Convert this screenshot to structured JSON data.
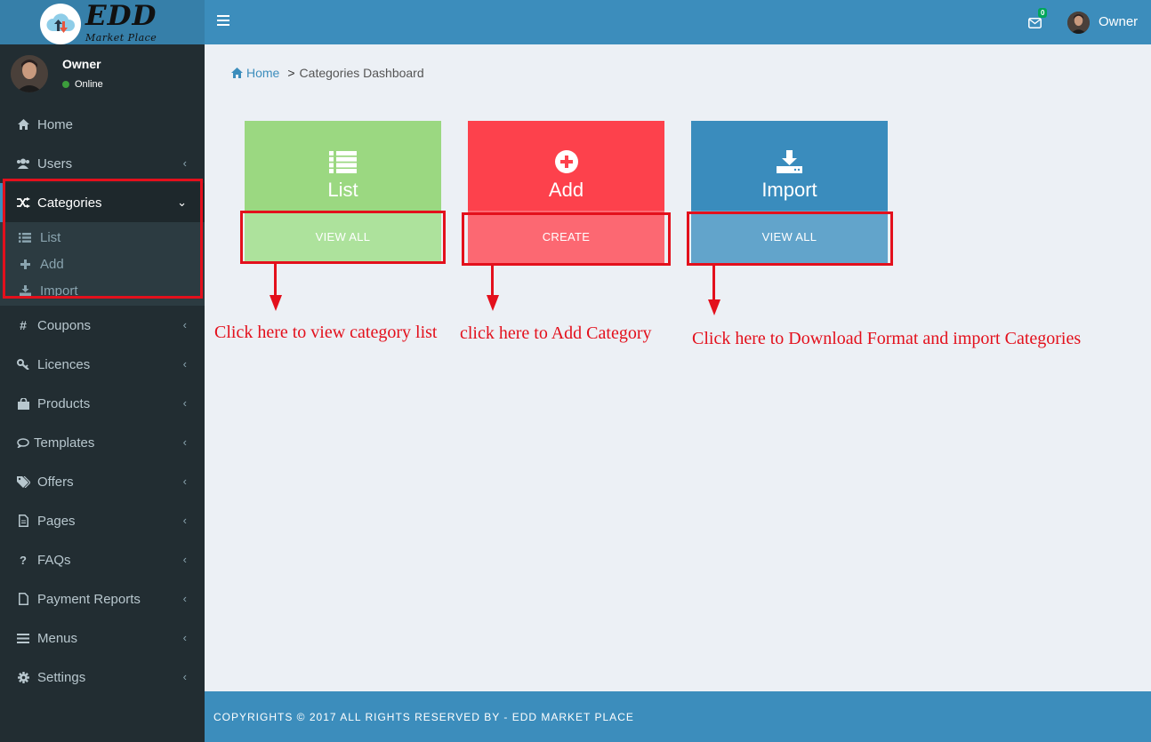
{
  "brand": {
    "name": "EDD",
    "tagline": "Market Place"
  },
  "user": {
    "name": "Owner",
    "status": "Online"
  },
  "header": {
    "mail_count": "0",
    "user_name": "Owner"
  },
  "sidebar": {
    "items": [
      {
        "label": "Home",
        "icon": "home-icon"
      },
      {
        "label": "Users",
        "icon": "users-icon"
      },
      {
        "label": "Categories",
        "icon": "shuffle-icon"
      },
      {
        "label": "Coupons",
        "icon": "hashtag-icon"
      },
      {
        "label": "Licences",
        "icon": "key-icon"
      },
      {
        "label": "Products",
        "icon": "shopping-bag-icon"
      },
      {
        "label": "Templates",
        "icon": "comment-icon"
      },
      {
        "label": "Offers",
        "icon": "tags-icon"
      },
      {
        "label": "Pages",
        "icon": "file-icon"
      },
      {
        "label": "FAQs",
        "icon": "question-icon"
      },
      {
        "label": "Payment Reports",
        "icon": "file-icon"
      },
      {
        "label": "Menus",
        "icon": "bars-icon"
      },
      {
        "label": "Settings",
        "icon": "gear-icon"
      }
    ],
    "categories_sub": [
      {
        "label": "List",
        "icon": "list-icon"
      },
      {
        "label": "Add",
        "icon": "plus-icon"
      },
      {
        "label": "Import",
        "icon": "download-icon"
      }
    ]
  },
  "breadcrumb": {
    "home": "Home",
    "separator": ">",
    "current": "Categories Dashboard"
  },
  "cards": [
    {
      "title": "List",
      "button": "VIEW ALL",
      "icon": "list-icon",
      "color": "#9bd881"
    },
    {
      "title": "Add",
      "button": "CREATE",
      "icon": "plus-circle-icon",
      "color": "#fd414c"
    },
    {
      "title": "Import",
      "button": "VIEW ALL",
      "icon": "download-icon",
      "color": "#3a8cbd"
    }
  ],
  "annotations": {
    "list": "Click here to view category list",
    "add": "click here to Add Category",
    "import": "Click here to Download Format and import Categories"
  },
  "footer": {
    "text": "COPYRIGHTS © 2017 ALL RIGHTS RESERVED BY - EDD MARKET PLACE"
  }
}
